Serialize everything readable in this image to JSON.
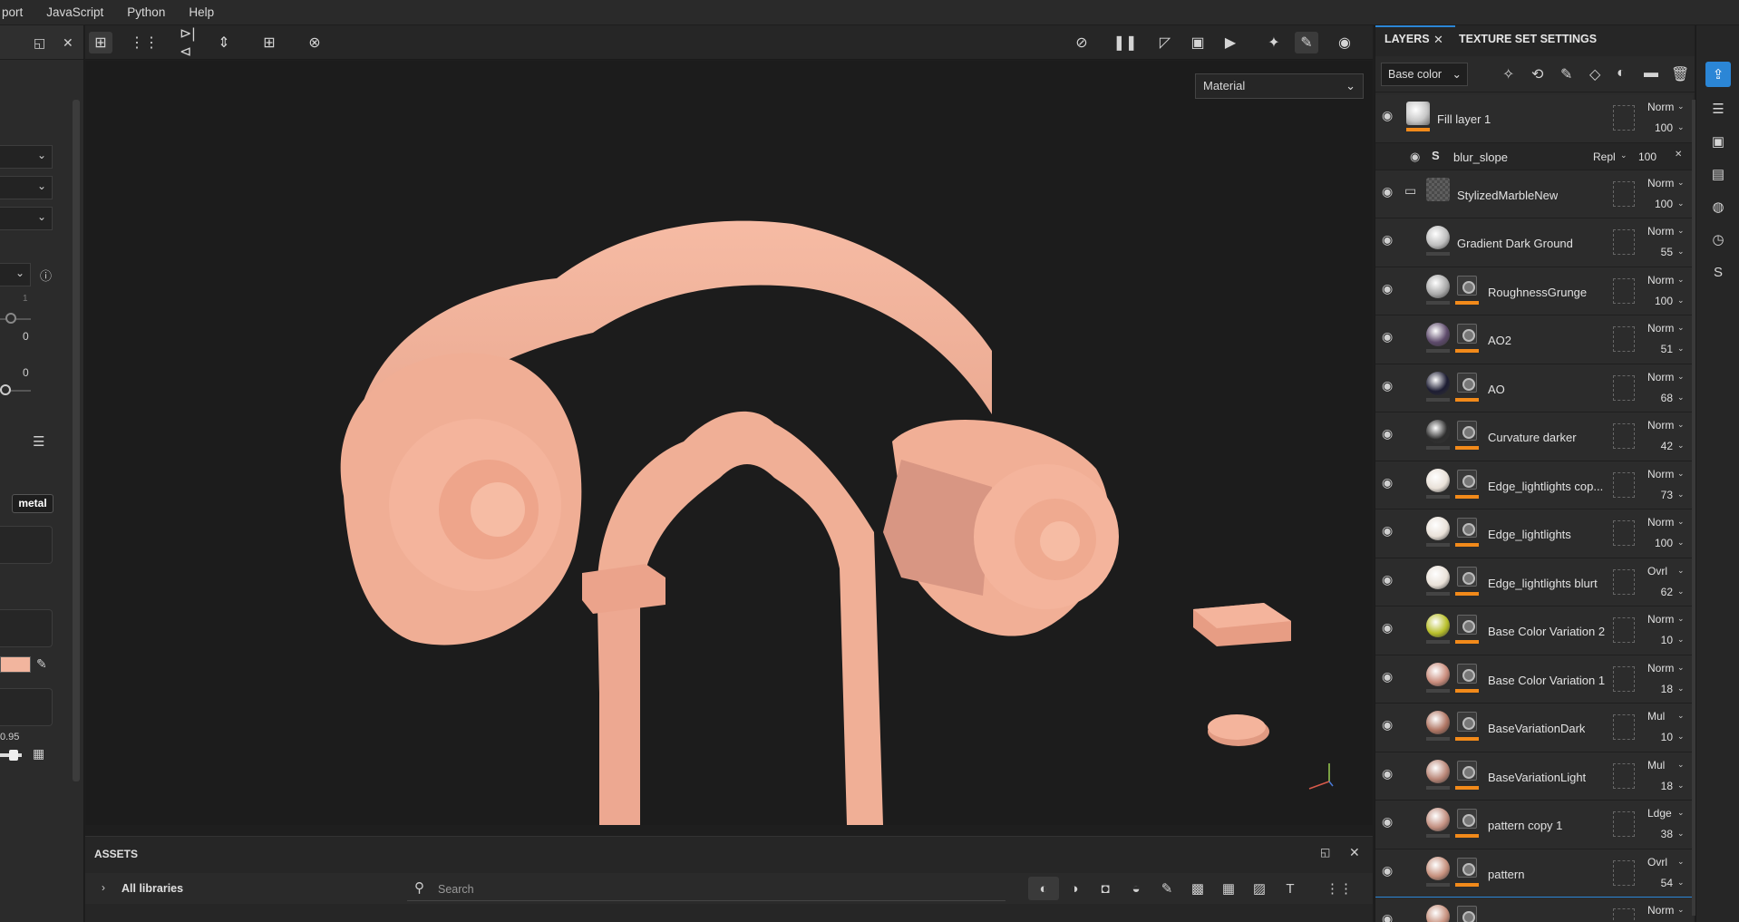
{
  "menu": [
    "port",
    "JavaScript",
    "Python",
    "Help"
  ],
  "left_panel": {
    "slider_values": [
      "1",
      "0",
      "0"
    ],
    "badge": "metal",
    "roughness_value": "0.95"
  },
  "viewport": {
    "display_mode": "Material"
  },
  "assets": {
    "title": "ASSETS",
    "libraries": "All libraries",
    "search_placeholder": "Search"
  },
  "layers_panel": {
    "tabs": [
      "LAYERS",
      "TEXTURE SET SETTINGS"
    ],
    "channel": "Base color",
    "layers": [
      {
        "name": "Fill layer 1",
        "blend": "Norm",
        "opacity": "100",
        "thumb": "#c8c8c8",
        "type": "fill"
      },
      {
        "name": "blur_slope",
        "blend": "Repl",
        "opacity": "100",
        "type": "sub"
      },
      {
        "name": "StylizedMarbleNew",
        "blend": "Norm",
        "opacity": "100",
        "thumb": "#555555",
        "type": "folder"
      },
      {
        "name": "Gradient Dark Ground",
        "blend": "Norm",
        "opacity": "55",
        "thumb": "#bdbdbd",
        "type": "plain"
      },
      {
        "name": "RoughnessGrunge",
        "blend": "Norm",
        "opacity": "100",
        "thumb": "#a9a9a9",
        "type": "mask"
      },
      {
        "name": "AO2",
        "blend": "Norm",
        "opacity": "51",
        "thumb": "#5d4a6b",
        "type": "mask"
      },
      {
        "name": "AO",
        "blend": "Norm",
        "opacity": "68",
        "thumb": "#1d1d33",
        "type": "mask"
      },
      {
        "name": "Curvature darker",
        "blend": "Norm",
        "opacity": "42",
        "thumb": "#2e2e2e",
        "type": "mask"
      },
      {
        "name": "Edge_lightlights cop...",
        "blend": "Norm",
        "opacity": "73",
        "thumb": "#e9e1d8",
        "type": "mask"
      },
      {
        "name": "Edge_lightlights",
        "blend": "Norm",
        "opacity": "100",
        "thumb": "#e9e1d8",
        "type": "mask"
      },
      {
        "name": "Edge_lightlights blurt",
        "blend": "Ovrl",
        "opacity": "62",
        "thumb": "#e9e1d8",
        "type": "mask"
      },
      {
        "name": "Base Color Variation 2",
        "blend": "Norm",
        "opacity": "10",
        "thumb": "#b8bf2a",
        "type": "mask"
      },
      {
        "name": "Base Color Variation 1",
        "blend": "Norm",
        "opacity": "18",
        "thumb": "#c98c7c",
        "type": "mask"
      },
      {
        "name": "BaseVariationDark",
        "blend": "Mul",
        "opacity": "10",
        "thumb": "#b07664",
        "type": "mask"
      },
      {
        "name": "BaseVariationLight",
        "blend": "Mul",
        "opacity": "18",
        "thumb": "#b98677",
        "type": "mask"
      },
      {
        "name": "pattern copy 1",
        "blend": "Ldge",
        "opacity": "38",
        "thumb": "#c28f80",
        "type": "mask"
      },
      {
        "name": "pattern",
        "blend": "Ovrl",
        "opacity": "54",
        "thumb": "#c6907d",
        "type": "mask"
      },
      {
        "name": "",
        "blend": "Norm",
        "opacity": "",
        "thumb": "#c6907d",
        "type": "mask"
      }
    ]
  },
  "colors": {
    "accent": "#2b86d6",
    "mask_bar": "#f28a1a",
    "model": "#f2b59e"
  }
}
